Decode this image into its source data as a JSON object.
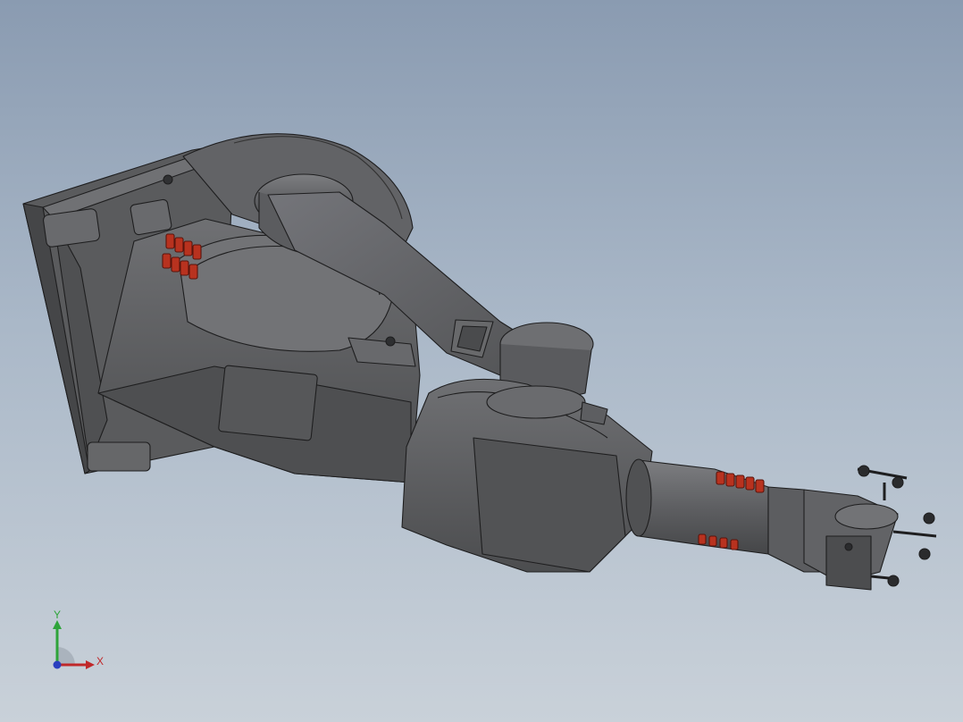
{
  "viewport": {
    "background_top": "#8a9bb1",
    "background_bottom": "#c9d1d9",
    "model": {
      "name": "industrial-robot-arm",
      "body_color": "#5f6062",
      "shade_color": "#4a4b4d",
      "highlight_color": "#77787b",
      "edge_color": "#1e1e1f",
      "accent_color": "#b8321f"
    }
  },
  "triad": {
    "x_label": "X",
    "y_label": "Y",
    "x_color": "#c0282a",
    "y_color": "#2ea43a",
    "z_color": "#2a3fbf"
  }
}
